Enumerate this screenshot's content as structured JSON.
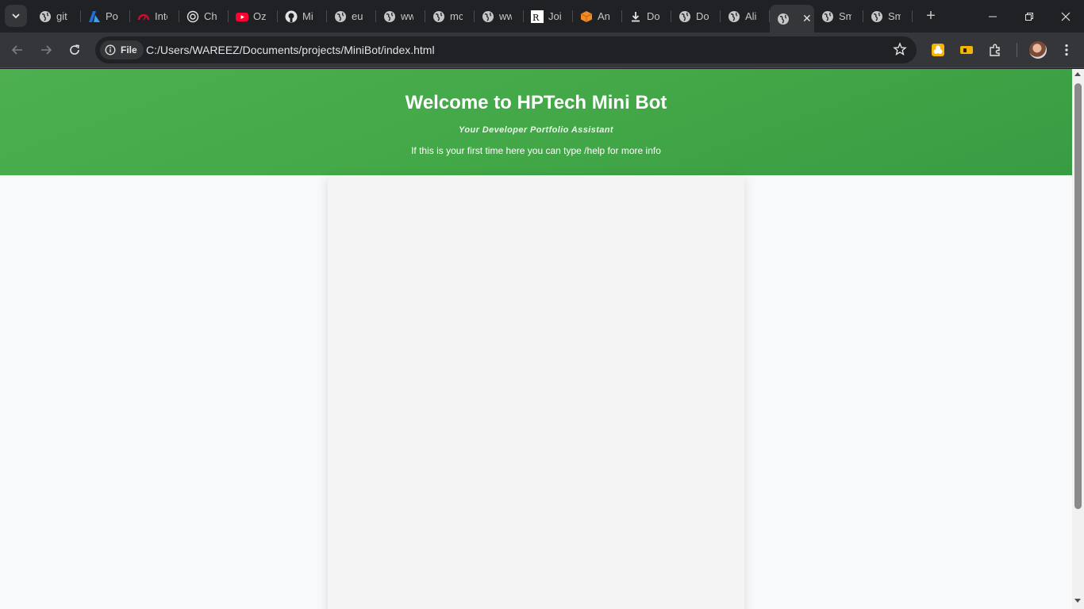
{
  "browser": {
    "tabs": [
      {
        "title": "git",
        "icon": "globe-icon"
      },
      {
        "title": "Por",
        "icon": "azure-icon"
      },
      {
        "title": "Inte",
        "icon": "gauge-icon"
      },
      {
        "title": "Ch",
        "icon": "chatgpt-icon"
      },
      {
        "title": "Oz",
        "icon": "youtube-icon"
      },
      {
        "title": "Mi",
        "icon": "github-icon"
      },
      {
        "title": "eu",
        "icon": "globe-icon"
      },
      {
        "title": "ww",
        "icon": "globe-icon"
      },
      {
        "title": "mc",
        "icon": "globe-icon"
      },
      {
        "title": "ww",
        "icon": "globe-icon"
      },
      {
        "title": "Joi",
        "icon": "researchgate-icon"
      },
      {
        "title": "An",
        "icon": "cube-icon"
      },
      {
        "title": "Do",
        "icon": "download-icon"
      },
      {
        "title": "Do",
        "icon": "globe-icon"
      },
      {
        "title": "Ali",
        "icon": "globe-icon"
      },
      {
        "title": "",
        "icon": "globe-icon",
        "active": true
      },
      {
        "title": "Sm",
        "icon": "globe-icon"
      },
      {
        "title": "Sm",
        "icon": "globe-icon"
      }
    ],
    "site_chip_label": "File",
    "url": "C:/Users/WAREEZ/Documents/projects/MiniBot/index.html",
    "colors": {
      "frame": "#202124",
      "toolbar": "#35363a"
    }
  },
  "page": {
    "title": "Welcome to HPTech Mini Bot",
    "subtitle": "Your Developer Portfolio Assistant",
    "hint": "If this is your first time here you can type /help for more info",
    "colors": {
      "header_green": "#43a847",
      "panel": "#f4f4f4",
      "background": "#f7f9fb"
    }
  }
}
